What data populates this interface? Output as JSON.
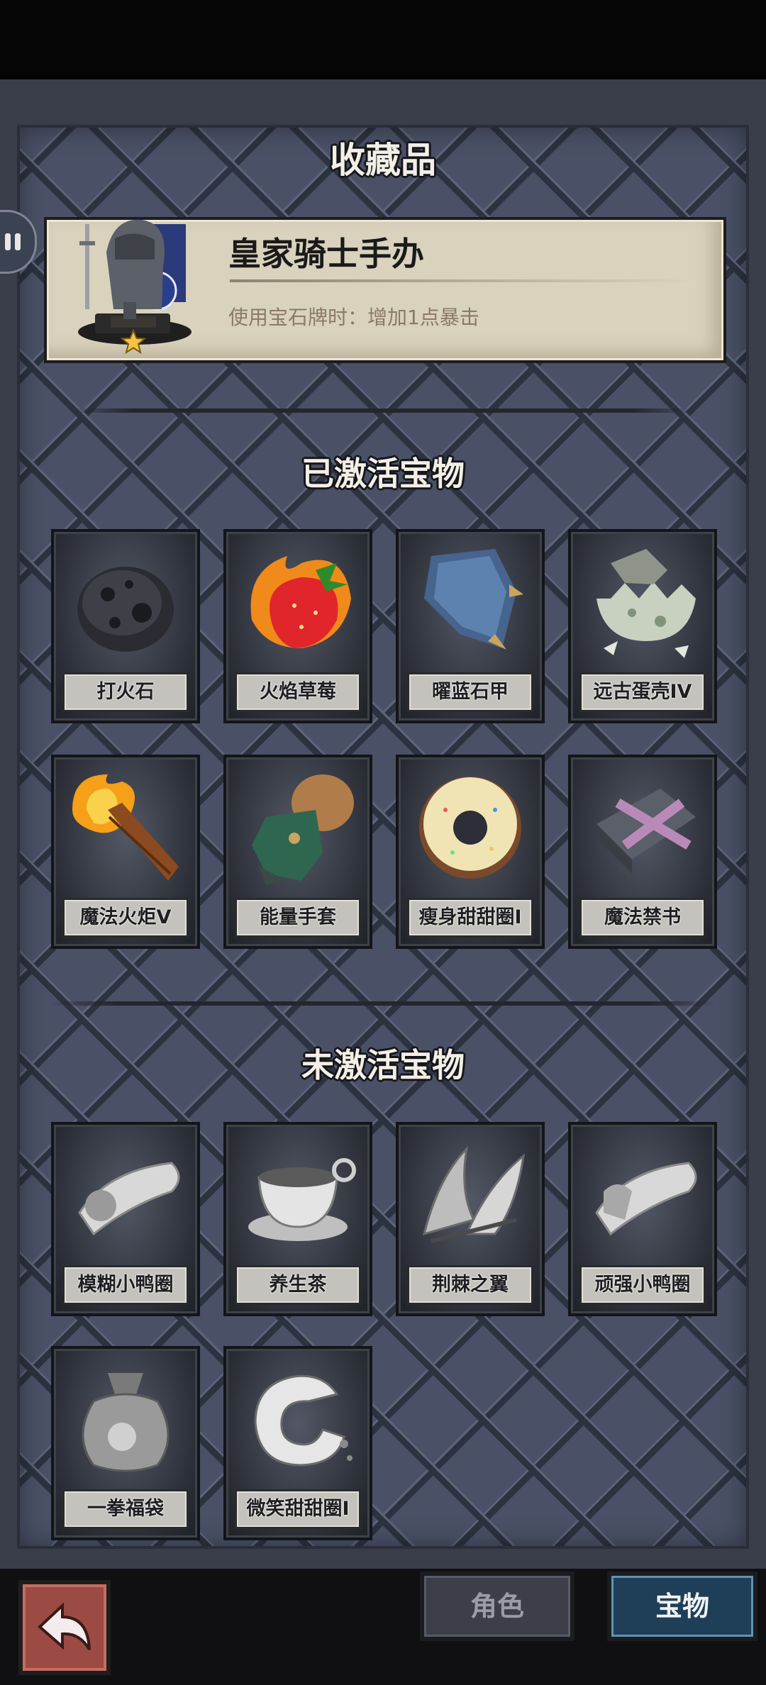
{
  "header": {
    "collection_title": "收藏品",
    "active_title": "已激活宝物",
    "inactive_title": "未激活宝物"
  },
  "featured": {
    "name": "皇家骑士手办",
    "description": "使用宝石牌时：增加1点暴击",
    "star_icon": "star-icon"
  },
  "active_items": [
    {
      "label": "打火石",
      "icon": "flint-stone-icon"
    },
    {
      "label": "火焰草莓",
      "icon": "flame-strawberry-icon"
    },
    {
      "label": "曜蓝石甲",
      "icon": "blue-armor-icon"
    },
    {
      "label": "远古蛋壳IV",
      "icon": "egg-shell-icon"
    },
    {
      "label": "魔法火炬V",
      "icon": "torch-icon"
    },
    {
      "label": "能量手套",
      "icon": "glove-icon"
    },
    {
      "label": "瘦身甜甜圈I",
      "icon": "donut-icon"
    },
    {
      "label": "魔法禁书",
      "icon": "forbidden-book-icon"
    }
  ],
  "inactive_items": [
    {
      "label": "模糊小鸭圈",
      "icon": "duck-ring-icon"
    },
    {
      "label": "养生茶",
      "icon": "tea-cup-icon"
    },
    {
      "label": "荆棘之翼",
      "icon": "thorn-wing-icon"
    },
    {
      "label": "顽强小鸭圈",
      "icon": "duck-ring-strong-icon"
    },
    {
      "label": "一拳福袋",
      "icon": "lucky-bag-icon"
    },
    {
      "label": "微笑甜甜圈I",
      "icon": "smile-donut-icon"
    }
  ],
  "bottom_nav": {
    "role_tab": "角色",
    "treasure_tab": "宝物",
    "back_icon": "back-arrow-icon"
  }
}
